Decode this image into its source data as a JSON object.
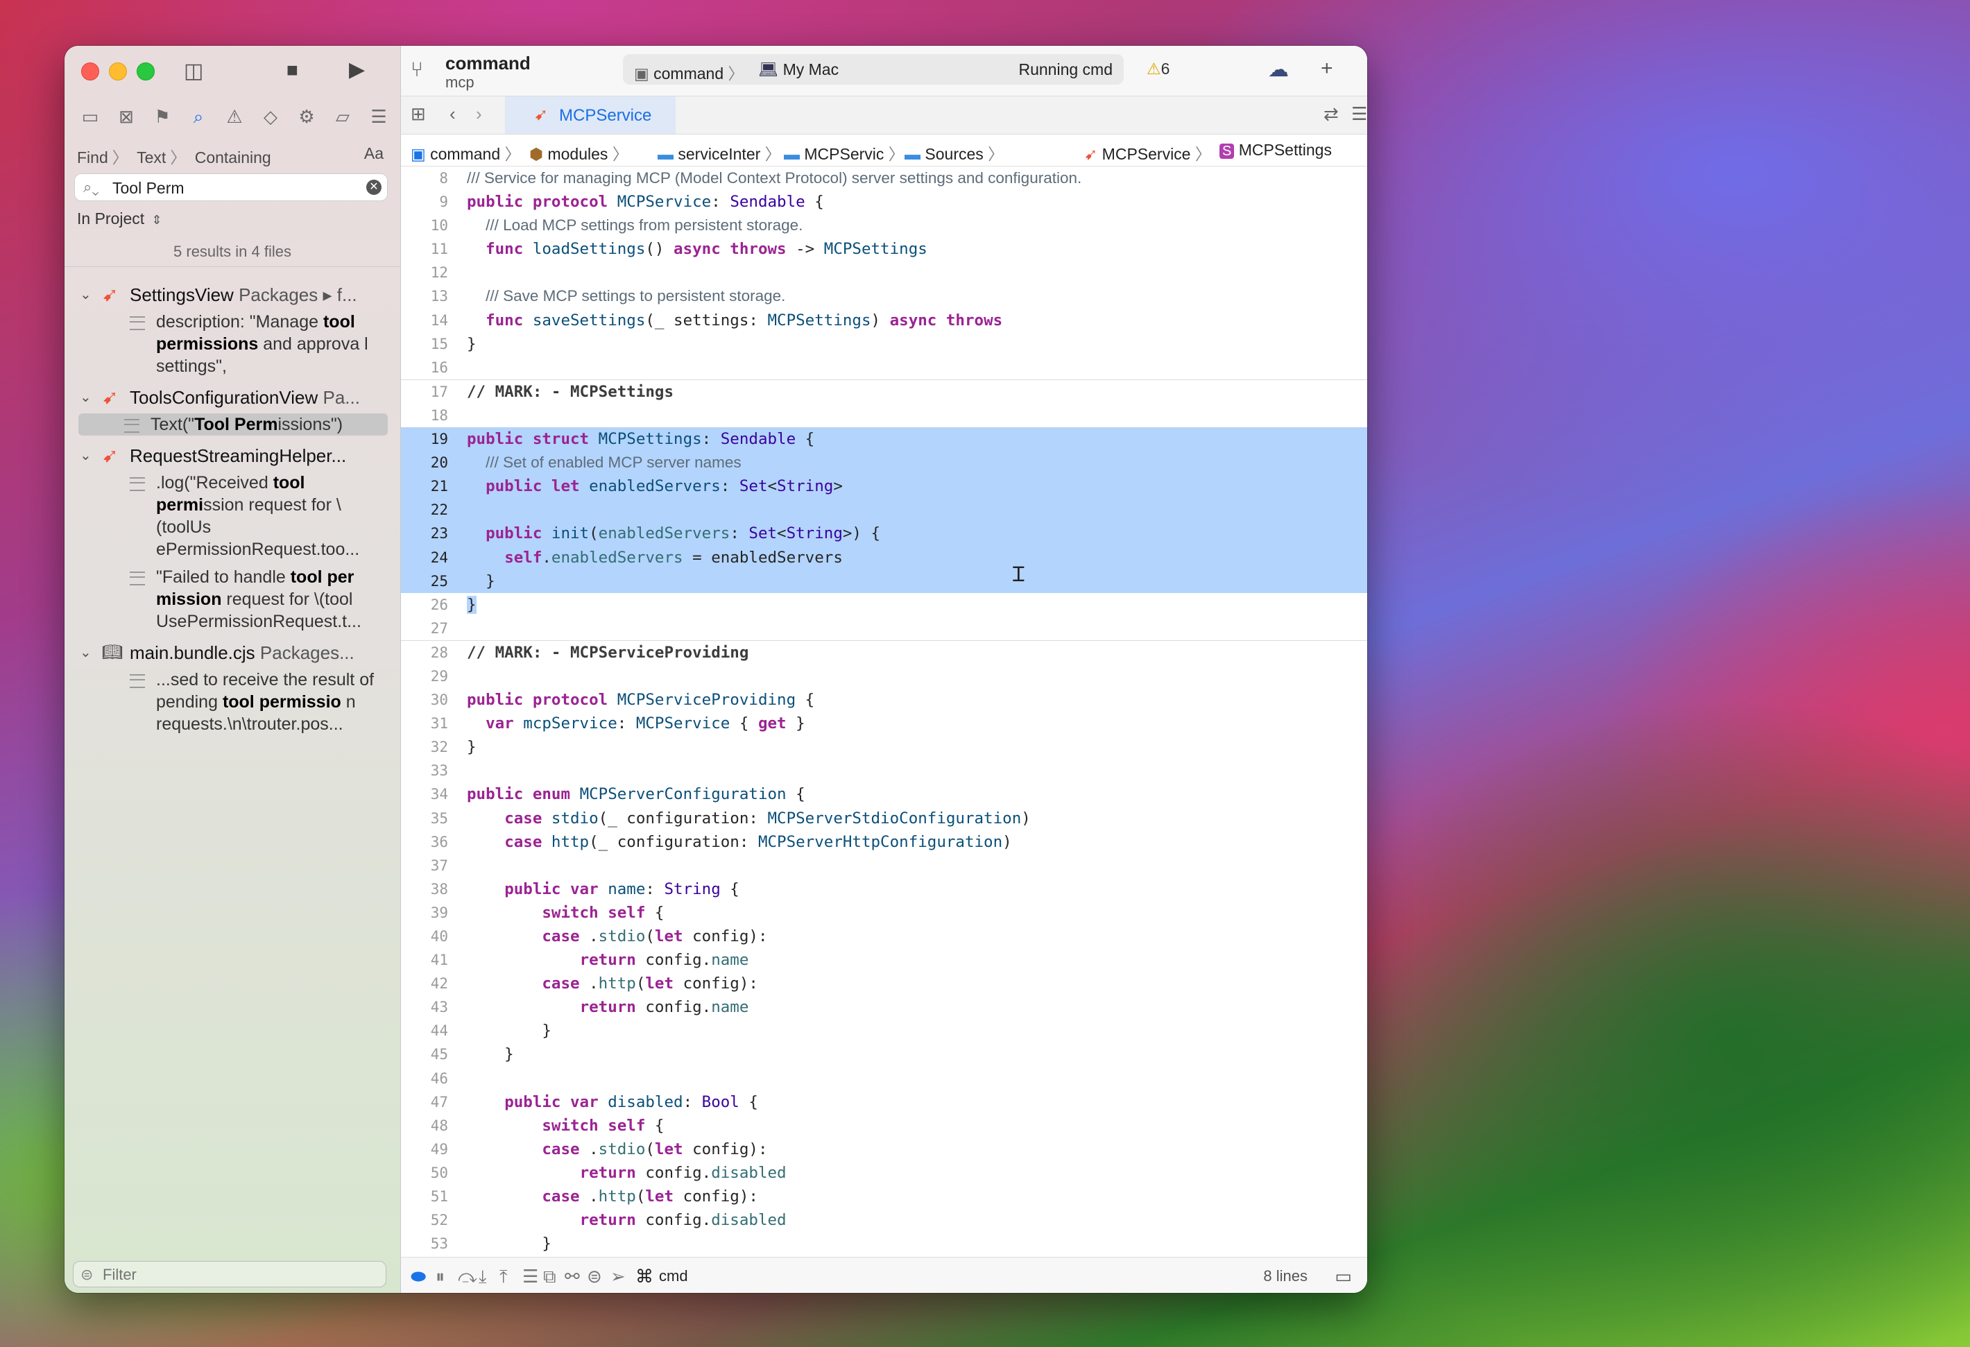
{
  "sidebar": {
    "find_parts": [
      "Find",
      "Text",
      "Containing"
    ],
    "match_case": "Aa",
    "search_value": "Tool Perm",
    "scope": "In Project",
    "summary": "5 results in 4 files",
    "filter_placeholder": "Filter",
    "files": [
      {
        "name": "SettingsView",
        "path": "Packages ▸ f...",
        "icon": "swift-icon"
      },
      {
        "name": "ToolsConfigurationView",
        "path": "Pa...",
        "icon": "swift-icon"
      },
      {
        "name": "RequestStreamingHelper...",
        "path": "",
        "icon": "swift-icon"
      },
      {
        "name": "main.bundle.cjs",
        "path": "Packages...",
        "icon": "book-icon"
      }
    ]
  },
  "titlebar": {
    "project": "command",
    "subtitle": "mcp",
    "scheme": "command",
    "destination": "My Mac",
    "status": "Running cmd",
    "warnings": "6"
  },
  "tab": {
    "label": "MCPService"
  },
  "jumpbar": [
    "command",
    "modules",
    "serviceInte⁠r",
    "MCPServic",
    "Sources",
    "MCPService",
    "MCPSettings"
  ],
  "debug": {
    "process": "cmd",
    "lines": "8 lines"
  },
  "colors": {
    "accent": "#1a73e8",
    "selection": "#b3d4fc",
    "swift": "#f05138"
  }
}
